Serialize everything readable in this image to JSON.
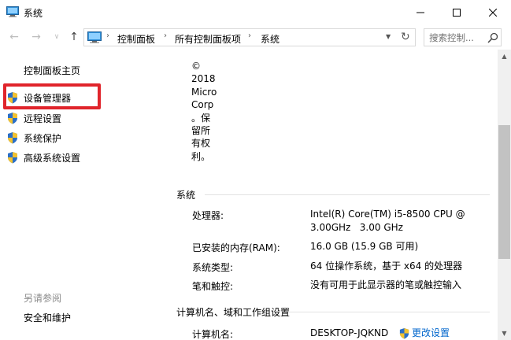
{
  "window": {
    "title": "系统",
    "minimize_glyph": "—",
    "maximize_glyph": "☐",
    "close_glyph": "✕"
  },
  "nav": {
    "back_glyph": "←",
    "forward_glyph": "→",
    "history_glyph": "∨",
    "up_glyph": "↑",
    "breadcrumbs": [
      "控制面板",
      "所有控制面板项",
      "系统"
    ],
    "separator": "›",
    "search_placeholder": "搜索控制..."
  },
  "sidebar": {
    "home": "控制面板主页",
    "items": [
      {
        "label": "设备管理器",
        "icon": "shield-icon"
      },
      {
        "label": "远程设置",
        "icon": "shield-icon"
      },
      {
        "label": "系统保护",
        "icon": "shield-icon"
      },
      {
        "label": "高级系统设置",
        "icon": "shield-icon"
      }
    ],
    "see_also": "另请参阅",
    "security": "安全和维护"
  },
  "content": {
    "copyright": "©\n2018\nMicro\nCorp\n。保\n留所\n有权\n利。",
    "system_section": {
      "title": "系统",
      "rows": [
        {
          "label": "处理器:",
          "value": "Intel(R) Core(TM) i5-8500 CPU @\n3.00GHz   3.00 GHz"
        },
        {
          "label": "已安装的内存(RAM):",
          "value": "16.0 GB (15.9 GB 可用)"
        },
        {
          "label": "系统类型:",
          "value": "64 位操作系统，基于 x64 的处理器"
        },
        {
          "label": "笔和触控:",
          "value": "没有可用于此显示器的笔或触控输入"
        }
      ]
    },
    "computer_section": {
      "title": "计算机名、域和工作组设置",
      "rows": [
        {
          "label": "计算机名:",
          "value": "DESKTOP-JQKND",
          "link": "更改设置"
        }
      ]
    }
  },
  "colors": {
    "highlight": "#e0242b",
    "link": "#0066cc",
    "shield_blue": "#2b6fc7",
    "shield_yellow": "#f2c230"
  }
}
